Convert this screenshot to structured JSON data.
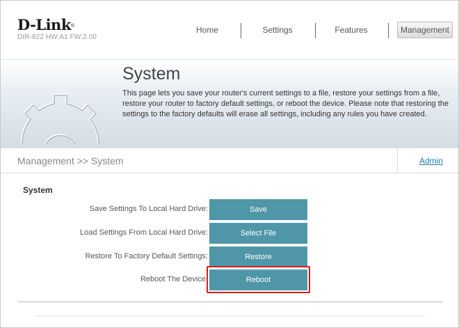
{
  "brand": {
    "logo": "D-Link",
    "model": "DIR-822 HW:A1 FW:2.00"
  },
  "nav": {
    "home": "Home",
    "settings": "Settings",
    "features": "Features",
    "management": "Management"
  },
  "banner": {
    "title": "System",
    "description": "This page lets you save your router's current settings to a file, restore your settings from a file, restore your router to factory default settings, or reboot the device. Please note that restoring the settings to the factory defaults will erase all settings, including any rules you have created."
  },
  "breadcrumb": {
    "text": "Management >> System",
    "admin_link": "Admin"
  },
  "section": {
    "title": "System",
    "rows": [
      {
        "label": "Save Settings To Local Hard Drive:",
        "button": "Save"
      },
      {
        "label": "Load Settings From Local Hard Drive:",
        "button": "Select File"
      },
      {
        "label": "Restore To Factory Default Settings:",
        "button": "Restore"
      },
      {
        "label": "Reboot The Device:",
        "button": "Reboot"
      }
    ]
  },
  "colors": {
    "button": "#4f96a8",
    "link": "#1f78b4",
    "highlight": "#e01818"
  }
}
